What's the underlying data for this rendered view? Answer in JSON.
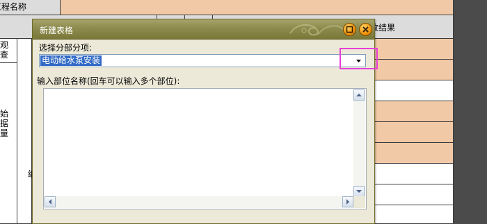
{
  "sheet": {
    "header_label": "单位工程名称",
    "header_label_visible": "工程名称",
    "result_header": "验收结果",
    "result_header_visible": "收结果",
    "row_group_1": [
      "观",
      "查"
    ],
    "row_group_2": [
      "始",
      "据",
      "量"
    ],
    "partial_char": "编"
  },
  "dialog": {
    "title": "新建表格",
    "select_label": "选择分部分项:",
    "select_value": "电动给水泵安装",
    "name_label": "输入部位名称(回车可以输入多个部位):",
    "textarea_value": "",
    "minimize_icon": "minimize-icon",
    "close_icon": "close-icon",
    "dropdown_icon": "chevron-down-icon"
  },
  "colors": {
    "peach": "#f2c9a6",
    "titlebar": "#8d8b4e",
    "selection": "#316ac5",
    "highlight": "#e83fd8"
  }
}
